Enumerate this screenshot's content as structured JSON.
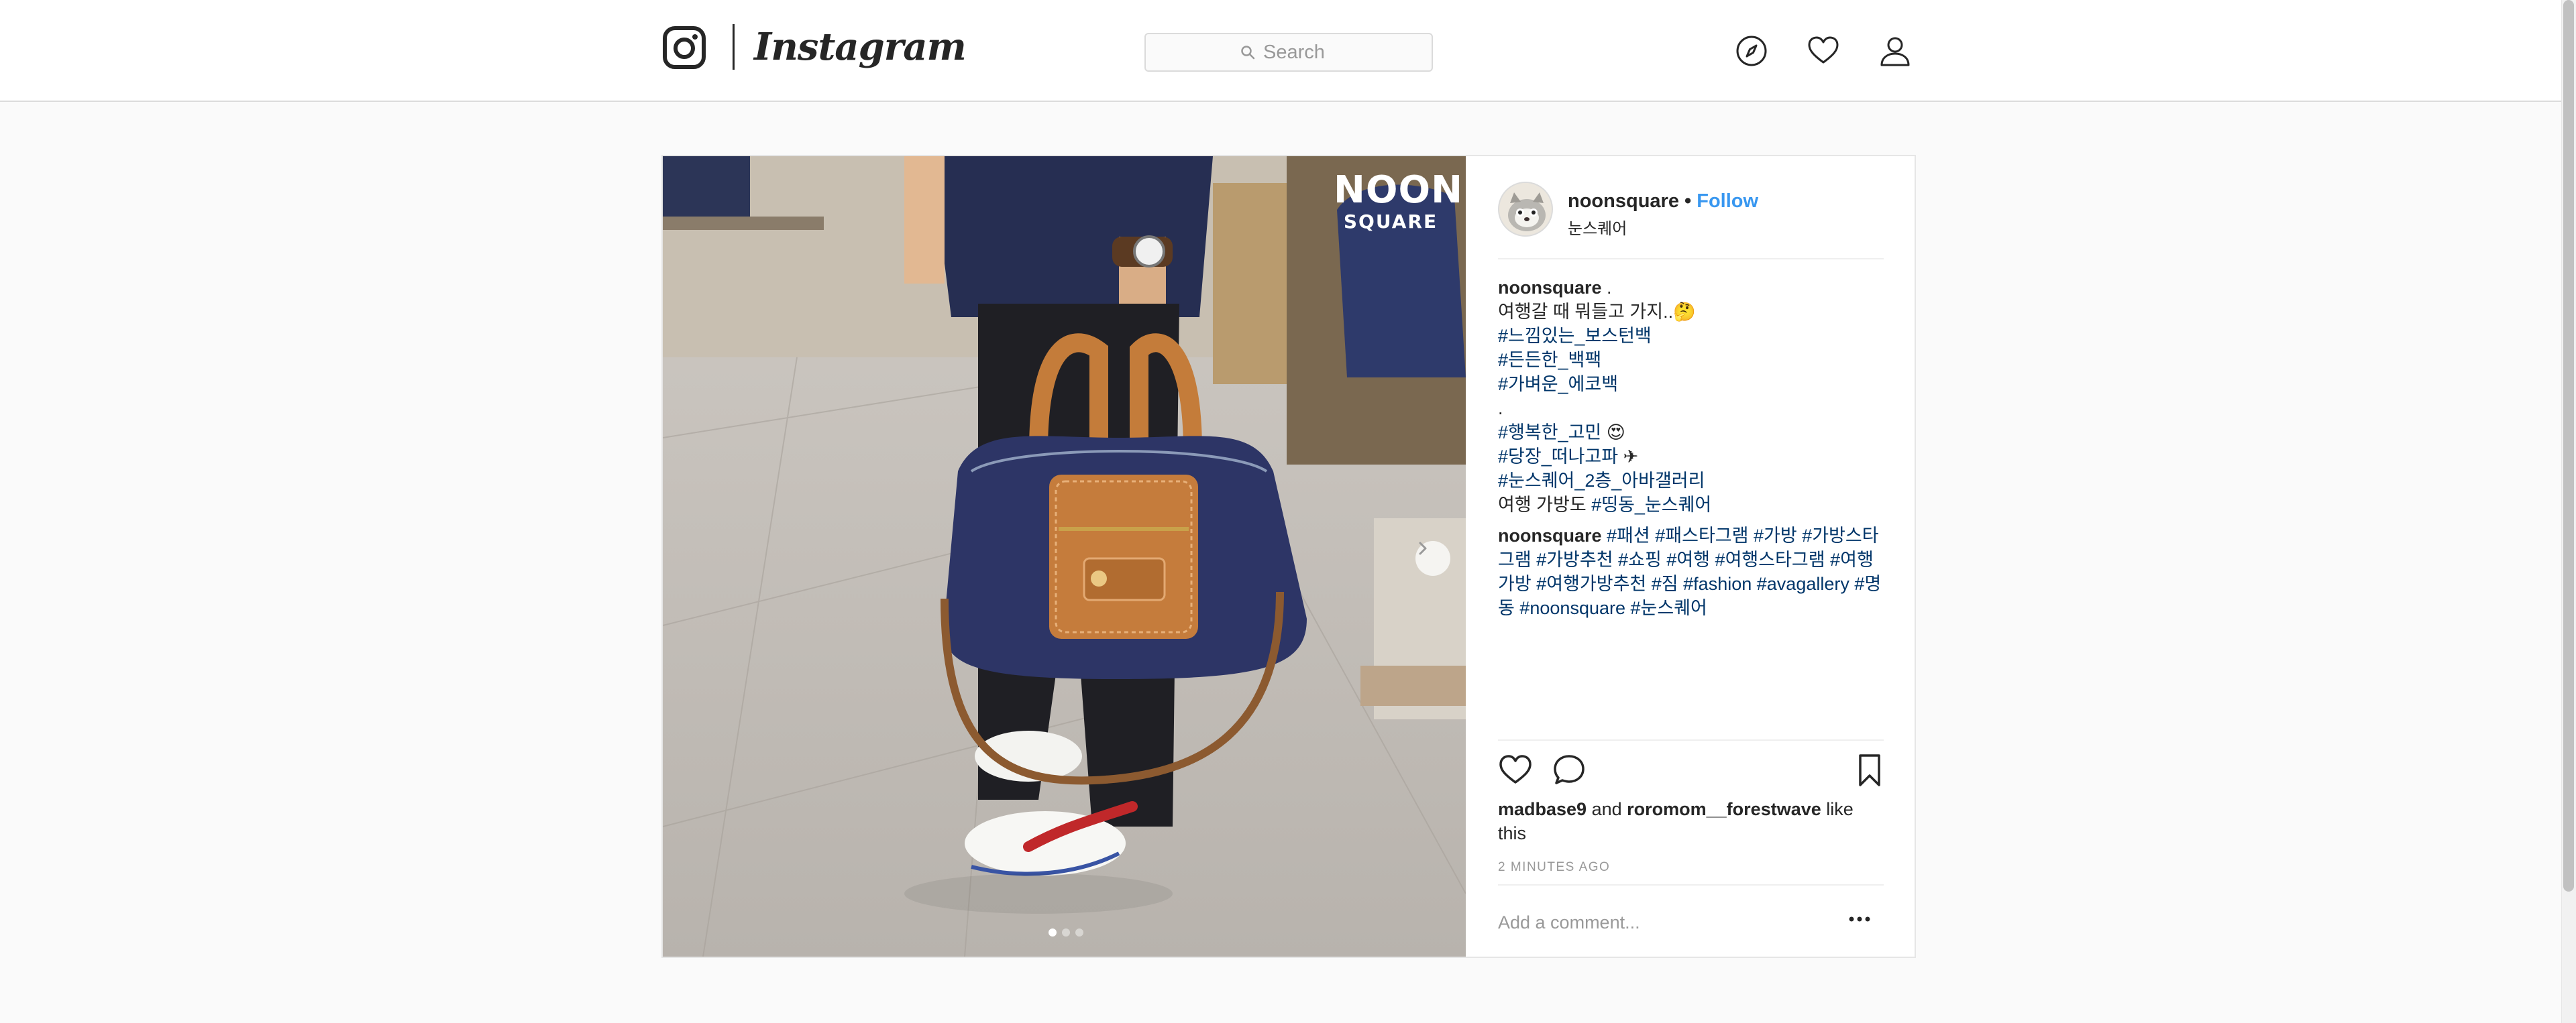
{
  "nav": {
    "brand": "Instagram",
    "search_placeholder": "Search",
    "icons": [
      "compass-icon",
      "heart-icon",
      "profile-icon"
    ]
  },
  "post": {
    "image": {
      "stamp_big": "NOON",
      "stamp_small": "SQUARE",
      "carousel_count": 3,
      "carousel_active": 1
    },
    "author": {
      "username": "noonsquare",
      "bullet": "•",
      "follow_label": "Follow",
      "location": "눈스퀘어"
    },
    "caption": {
      "username": "noonsquare",
      "line1_suffix": " .",
      "line2": "여행갈 때 뭐들고 가지..🤔",
      "tag1": "#느낌있는_보스턴백",
      "tag2": "#든든한_백팩",
      "tag3": "#가벼운_에코백",
      "dot_line": ".",
      "tag4": "#행복한_고민",
      "tag4_emoji": " 😍",
      "tag5": "#당장_떠나고파",
      "tag5_emoji": " ✈",
      "tag6": "#눈스퀘어_2층_아바갤러리",
      "line_last_prefix": "여행 가방도 ",
      "tag7": "#띵동_눈스퀘어"
    },
    "comment": {
      "username": "noonsquare",
      "tags": [
        "#패션",
        "#패스타그램",
        "#가방",
        "#가방스타그램",
        "#가방추천",
        "#쇼핑",
        "#여행",
        "#여행스타그램",
        "#여행가방",
        "#여행가방추천",
        "#짐",
        "#fashion",
        "#avagallery",
        "#명동",
        "#noonsquare",
        "#눈스퀘어"
      ]
    },
    "likes": {
      "user1": "madbase9",
      "connector": " and ",
      "user2": "roromom__forestwave",
      "suffix": " like this"
    },
    "timestamp": "2 MINUTES AGO",
    "comment_placeholder": "Add a comment...",
    "colors": {
      "link": "#003569",
      "follow": "#3897f0",
      "muted": "#999999",
      "border": "#dbdbdb"
    }
  }
}
